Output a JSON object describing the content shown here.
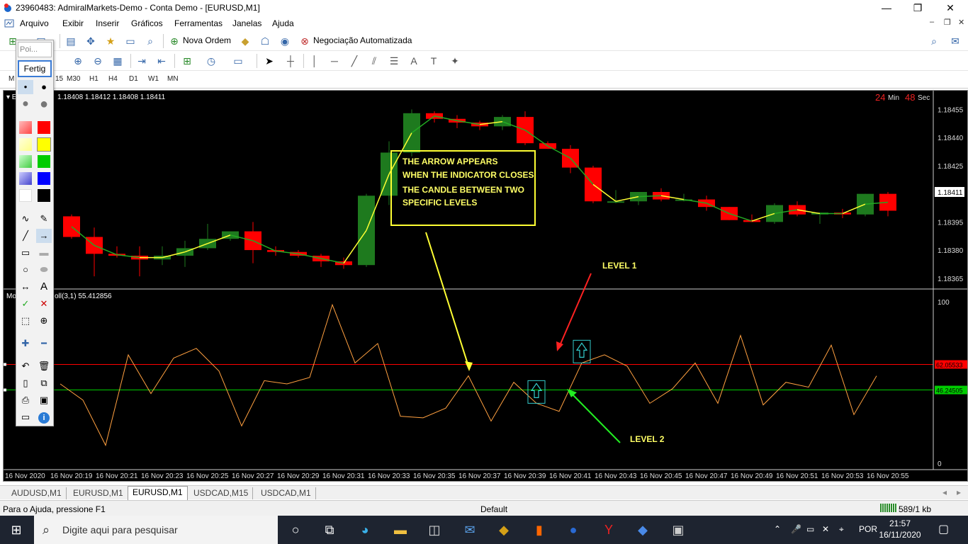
{
  "window": {
    "title": "23960483: AdmiralMarkets-Demo - Conta Demo - [EURUSD,M1]",
    "minimize": "—",
    "maximize": "❐",
    "close": "✕"
  },
  "menu": [
    "Arquivo",
    "Exibir",
    "Inserir",
    "Gráficos",
    "Ferramentas",
    "Janelas",
    "Ajuda"
  ],
  "toolbar": {
    "new_order": "Nova Ordem",
    "auto_trading": "Negociação Automatizada",
    "timeframes": [
      "M",
      "15",
      "M30",
      "H1",
      "H4",
      "D1",
      "W1",
      "MN"
    ]
  },
  "palette": {
    "search_placeholder": "Poi...",
    "done_button": "Fertig",
    "text_tool": "A",
    "help_icon": "i"
  },
  "chart": {
    "ohlc": "1.18408 1.18412 1.18408 1.18411",
    "symbol_stub": "E",
    "indicator_prefix": "Mo",
    "indicator_value": "oll(3,1) 55.412856",
    "timer": {
      "min_value": "24",
      "min_label": "Min",
      "sec_value": "48",
      "sec_label": "Sec"
    },
    "price_ticks": [
      "1.18455",
      "1.18440",
      "1.18425",
      "1.18411",
      "1.18395",
      "1.18380",
      "1.18365"
    ],
    "current_price": "1.18411",
    "osc_ticks": {
      "top": "100",
      "bottom": "0"
    },
    "level1_value": "62.05533",
    "level2_value": "46.24505",
    "time_ticks": [
      "16 Nov 2020",
      "16 Nov 20:19",
      "16 Nov 20:21",
      "16 Nov 20:23",
      "16 Nov 20:25",
      "16 Nov 20:27",
      "16 Nov 20:29",
      "16 Nov 20:31",
      "16 Nov 20:33",
      "16 Nov 20:35",
      "16 Nov 20:37",
      "16 Nov 20:39",
      "16 Nov 20:41",
      "16 Nov 20:43",
      "16 Nov 20:45",
      "16 Nov 20:47",
      "16 Nov 20:49",
      "16 Nov 20:51",
      "16 Nov 20:53",
      "16 Nov 20:55"
    ],
    "annotation_lines": [
      "THE ARROW APPEARS",
      "WHEN THE INDICATOR CLOSES",
      "THE CANDLE BETWEEN TWO",
      "SPECIFIC LEVELS"
    ],
    "level1_label": "LEVEL 1",
    "level2_label": "LEVEL 2",
    "colors": {
      "bull": "#1e7a1e",
      "bear": "#ff0000",
      "ma": "#ffff33",
      "ma_green": "#22aa22",
      "osc": "#ffa040",
      "level1": "#ff0000",
      "level2": "#00cc00",
      "arrow_box": "#33cccc"
    }
  },
  "chart_data": {
    "type": "candlestick",
    "x": [
      "16 Nov 20:18",
      "16 Nov 20:19",
      "16 Nov 20:20",
      "16 Nov 20:21",
      "16 Nov 20:22",
      "16 Nov 20:23",
      "16 Nov 20:24",
      "16 Nov 20:25",
      "16 Nov 20:26",
      "16 Nov 20:27",
      "16 Nov 20:28",
      "16 Nov 20:29",
      "16 Nov 20:30",
      "16 Nov 20:31",
      "16 Nov 20:32",
      "16 Nov 20:33",
      "16 Nov 20:34",
      "16 Nov 20:35",
      "16 Nov 20:36",
      "16 Nov 20:37",
      "16 Nov 20:38",
      "16 Nov 20:39",
      "16 Nov 20:40",
      "16 Nov 20:41",
      "16 Nov 20:42",
      "16 Nov 20:43",
      "16 Nov 20:44",
      "16 Nov 20:45",
      "16 Nov 20:46",
      "16 Nov 20:47",
      "16 Nov 20:48",
      "16 Nov 20:49",
      "16 Nov 20:50",
      "16 Nov 20:51",
      "16 Nov 20:52",
      "16 Nov 20:53",
      "16 Nov 20:54"
    ],
    "open": [
      1.18398,
      1.18387,
      1.18378,
      1.18377,
      1.18375,
      1.18377,
      1.18381,
      1.18386,
      1.1839,
      1.1838,
      1.18379,
      1.18377,
      1.18374,
      1.18372,
      1.18409,
      1.18432,
      1.18453,
      1.1845,
      1.18448,
      1.18446,
      1.18451,
      1.18437,
      1.18434,
      1.18424,
      1.18406,
      1.18406,
      1.18411,
      1.18407,
      1.18407,
      1.18403,
      1.18396,
      1.18395,
      1.18404,
      1.18399,
      1.184,
      1.18399,
      1.1841
    ],
    "high": [
      1.18399,
      1.18392,
      1.18382,
      1.18382,
      1.18382,
      1.18385,
      1.18394,
      1.18388,
      1.18395,
      1.18382,
      1.1838,
      1.18378,
      1.18376,
      1.1841,
      1.18438,
      1.18455,
      1.18454,
      1.18452,
      1.18449,
      1.18452,
      1.18454,
      1.18438,
      1.18436,
      1.18425,
      1.18412,
      1.1841,
      1.18413,
      1.1841,
      1.18409,
      1.18403,
      1.18399,
      1.18405,
      1.18406,
      1.184,
      1.18402,
      1.1841,
      1.18411
    ],
    "low": [
      1.18386,
      1.18366,
      1.18376,
      1.18366,
      1.18372,
      1.18371,
      1.1838,
      1.18385,
      1.18373,
      1.18377,
      1.18376,
      1.18371,
      1.1837,
      1.18371,
      1.18404,
      1.1843,
      1.18448,
      1.18445,
      1.18444,
      1.18444,
      1.18436,
      1.18434,
      1.18421,
      1.18405,
      1.18405,
      1.18404,
      1.18406,
      1.18406,
      1.18401,
      1.18396,
      1.18395,
      1.18394,
      1.18398,
      1.18394,
      1.18397,
      1.18398,
      1.18398
    ],
    "close": [
      1.18387,
      1.18378,
      1.18377,
      1.18375,
      1.18377,
      1.18381,
      1.18386,
      1.1839,
      1.1838,
      1.18379,
      1.18377,
      1.18374,
      1.18372,
      1.18409,
      1.18432,
      1.18453,
      1.1845,
      1.18448,
      1.18446,
      1.18451,
      1.18437,
      1.18434,
      1.18424,
      1.18406,
      1.18406,
      1.18411,
      1.18407,
      1.18407,
      1.18403,
      1.18396,
      1.18395,
      1.18404,
      1.18399,
      1.184,
      1.18399,
      1.1841,
      1.18401
    ],
    "oscillator": {
      "name": "Mo",
      "series": [
        {
          "name": "",
          "values": [
            50,
            40,
            12,
            68,
            44,
            66,
            72,
            58,
            24,
            52,
            50,
            54,
            99,
            63,
            75,
            30,
            29,
            35,
            55,
            27,
            51,
            38,
            33,
            63,
            68,
            61,
            38,
            47,
            63,
            38,
            80,
            37,
            51,
            48,
            74,
            31,
            55
          ]
        }
      ],
      "levels": [
        62.05533,
        46.24505
      ],
      "ylim": [
        0,
        100
      ]
    },
    "ylim": [
      1.1836,
      1.18462
    ]
  },
  "tabs": [
    "AUDUSD,M1",
    "EURUSD,M1",
    "EURUSD,M1",
    "USDCAD,M15",
    "USDCAD,M1"
  ],
  "active_tab_index": 2,
  "status": {
    "help": "Para o Ajuda, pressione F1",
    "profile": "Default",
    "traffic": "589/1 kb"
  },
  "taskbar": {
    "search_placeholder": "Digite aqui para pesquisar",
    "lang": "POR",
    "time": "21:57",
    "date": "16/11/2020"
  }
}
